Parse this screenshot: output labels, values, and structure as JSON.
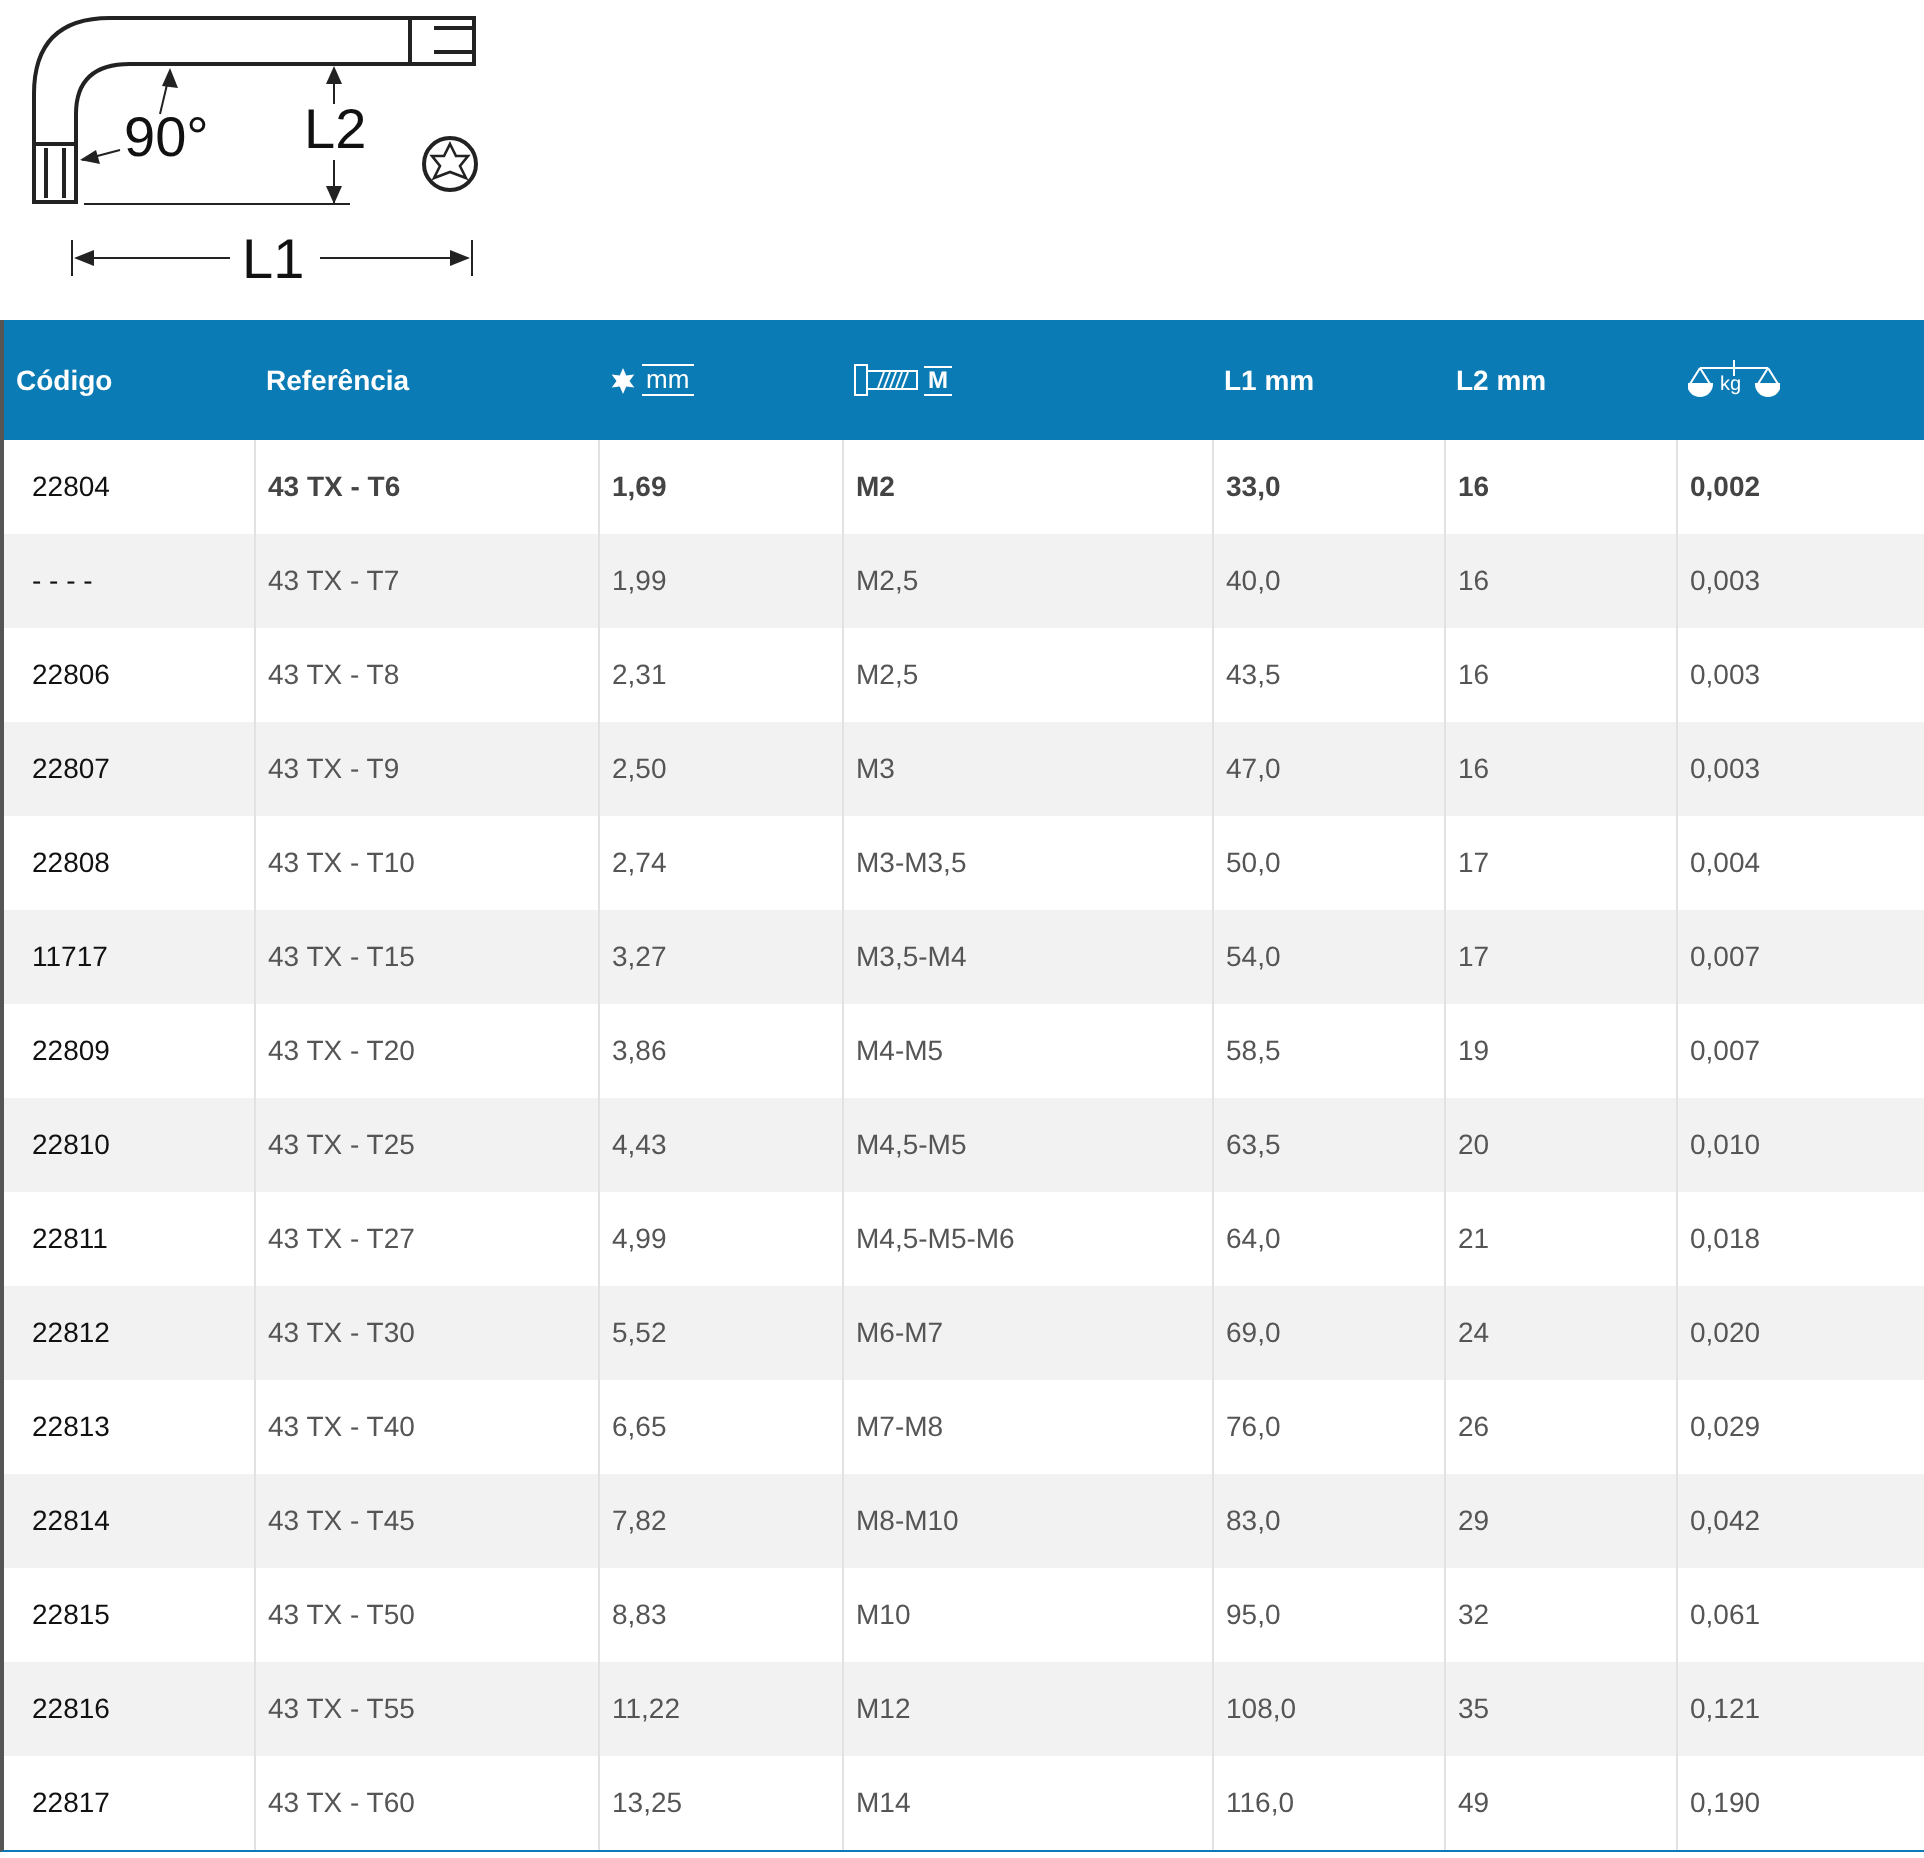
{
  "diagram": {
    "angle_label": "90°",
    "l2_label": "L2",
    "l1_label": "L1"
  },
  "table": {
    "columns": [
      {
        "kind": "text",
        "label": "Código"
      },
      {
        "kind": "text",
        "label": "Referência"
      },
      {
        "kind": "torx",
        "label": "mm"
      },
      {
        "kind": "bolt",
        "label": "M"
      },
      {
        "kind": "text",
        "label": "L1 mm"
      },
      {
        "kind": "text",
        "label": "L2 mm"
      },
      {
        "kind": "weight",
        "label": "kg"
      }
    ],
    "rows": [
      {
        "highlighted": true,
        "cells": [
          "22804",
          "43 TX - T6",
          "1,69",
          "M2",
          "33,0",
          "16",
          "0,002"
        ]
      },
      {
        "highlighted": false,
        "cells": [
          "- - - -",
          "43 TX - T7",
          "1,99",
          "M2,5",
          "40,0",
          "16",
          "0,003"
        ]
      },
      {
        "highlighted": false,
        "cells": [
          "22806",
          "43 TX - T8",
          "2,31",
          "M2,5",
          "43,5",
          "16",
          "0,003"
        ]
      },
      {
        "highlighted": false,
        "cells": [
          "22807",
          "43 TX - T9",
          "2,50",
          "M3",
          "47,0",
          "16",
          "0,003"
        ]
      },
      {
        "highlighted": false,
        "cells": [
          "22808",
          "43 TX - T10",
          "2,74",
          "M3-M3,5",
          "50,0",
          "17",
          "0,004"
        ]
      },
      {
        "highlighted": false,
        "cells": [
          "11717",
          "43 TX - T15",
          "3,27",
          "M3,5-M4",
          "54,0",
          "17",
          "0,007"
        ]
      },
      {
        "highlighted": false,
        "cells": [
          "22809",
          "43 TX - T20",
          "3,86",
          "M4-M5",
          "58,5",
          "19",
          "0,007"
        ]
      },
      {
        "highlighted": false,
        "cells": [
          "22810",
          "43 TX - T25",
          "4,43",
          "M4,5-M5",
          "63,5",
          "20",
          "0,010"
        ]
      },
      {
        "highlighted": false,
        "cells": [
          "22811",
          "43 TX - T27",
          "4,99",
          "M4,5-M5-M6",
          "64,0",
          "21",
          "0,018"
        ]
      },
      {
        "highlighted": false,
        "cells": [
          "22812",
          "43 TX - T30",
          "5,52",
          "M6-M7",
          "69,0",
          "24",
          "0,020"
        ]
      },
      {
        "highlighted": false,
        "cells": [
          "22813",
          "43 TX - T40",
          "6,65",
          "M7-M8",
          "76,0",
          "26",
          "0,029"
        ]
      },
      {
        "highlighted": false,
        "cells": [
          "22814",
          "43 TX - T45",
          "7,82",
          "M8-M10",
          "83,0",
          "29",
          "0,042"
        ]
      },
      {
        "highlighted": false,
        "cells": [
          "22815",
          "43 TX - T50",
          "8,83",
          "M10",
          "95,0",
          "32",
          "0,061"
        ]
      },
      {
        "highlighted": false,
        "cells": [
          "22816",
          "43 TX - T55",
          "11,22",
          "M12",
          "108,0",
          "35",
          "0,121"
        ]
      },
      {
        "highlighted": false,
        "cells": [
          "22817",
          "43 TX - T60",
          "13,25",
          "M14",
          "116,0",
          "49",
          "0,190"
        ]
      }
    ]
  }
}
